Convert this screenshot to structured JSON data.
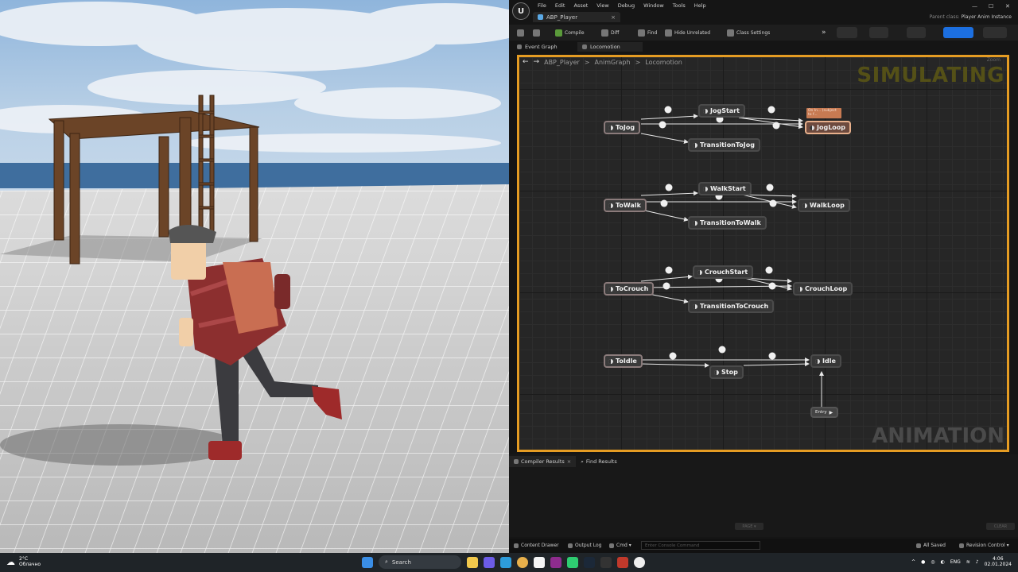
{
  "menu": {
    "logo": "U",
    "items": [
      "File",
      "Edit",
      "Asset",
      "View",
      "Debug",
      "Window",
      "Tools",
      "Help"
    ],
    "window_controls": [
      "—",
      "☐",
      "✕"
    ]
  },
  "document_tab": {
    "label": "ABP_Player",
    "close": "×"
  },
  "parent_class": {
    "label": "Parent class:",
    "value": "Player Anim Instance"
  },
  "toolbar": {
    "compile": "Compile",
    "diff": "Diff",
    "find": "Find",
    "hide_unrelated": "Hide Unrelated",
    "class_settings": "Class Settings",
    "more": "»"
  },
  "graph_tabs": [
    "Event Graph",
    "Locomotion"
  ],
  "breadcrumb": {
    "back": "←",
    "forward": "→",
    "items": [
      "ABP_Player",
      "AnimGraph",
      "Locomotion"
    ],
    "separator": ">"
  },
  "zoom": "Zoom",
  "overlay": {
    "simulating": "SIMULATING",
    "animation": "ANIMATION"
  },
  "sticky_note": "On In... (subject to f...",
  "nodes": {
    "tojog": "ToJog",
    "jogstart": "JogStart",
    "transitiontojog": "TransitionToJog",
    "jogloop": "JogLoop",
    "towalk": "ToWalk",
    "walkstart": "WalkStart",
    "transitiontowalk": "TransitionToWalk",
    "walkloop": "WalkLoop",
    "tocrouch": "ToCrouch",
    "crouchstart": "CrouchStart",
    "transitiontocrouch": "TransitionToCrouch",
    "crouchloop": "CrouchLoop",
    "toidle": "ToIdle",
    "stop": "Stop",
    "idle": "Idle",
    "entry": "Entry"
  },
  "bottom_panel": {
    "tabs": [
      "Compiler Results",
      "Find Results"
    ],
    "page": "PAGE ▾",
    "clear": "CLEAR"
  },
  "status_bar": {
    "content_drawer": "Content Drawer",
    "output_log": "Output Log",
    "cmd": "Cmd ▾",
    "console_placeholder": "Enter Console Command",
    "all_saved": "All Saved",
    "revision_control": "Revision Control ▾"
  },
  "taskbar": {
    "temperature": "2°C",
    "weather": "Облачно",
    "search": "Search",
    "language": "ENG",
    "time": "4:06",
    "date": "02.01.2024"
  },
  "colors": {
    "accent_orange": "#e59c23",
    "active_state": "#6d4a3e",
    "toolbar_blue": "#1c6fe0",
    "sky": "#8fb5dc"
  }
}
